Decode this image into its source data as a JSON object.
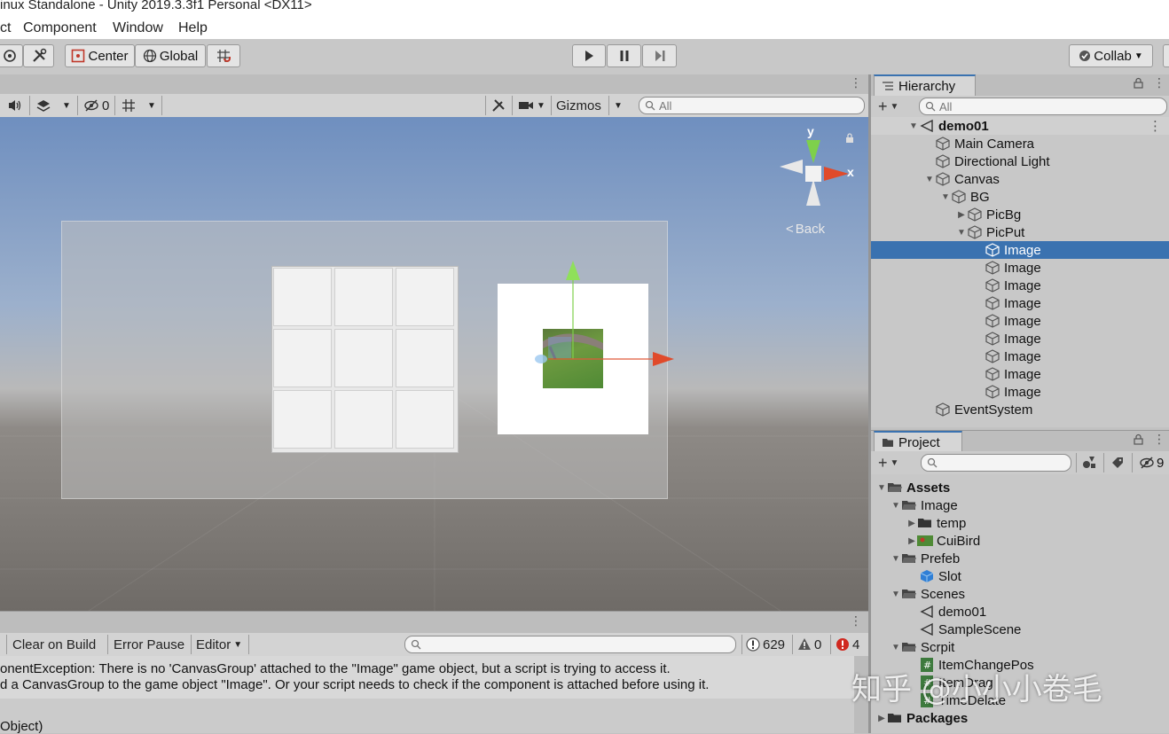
{
  "window": {
    "title": "inux Standalone - Unity 2019.3.3f1 Personal <DX11>"
  },
  "menu": [
    "ct",
    "Component",
    "Window",
    "Help"
  ],
  "toolbar": {
    "center_label": "Center",
    "global_label": "Global",
    "collab_label": "Collab"
  },
  "scene": {
    "hidden_count": "0",
    "gizmos_label": "Gizmos",
    "search_placeholder": "All",
    "back_label": "Back",
    "axis_y": "y",
    "axis_x": "x"
  },
  "console": {
    "clear_on_build": "Clear on Build",
    "error_pause": "Error Pause",
    "editor_label": "Editor",
    "info_count": "629",
    "warn_count": "0",
    "error_count": "4",
    "lines": [
      "onentException: There is no 'CanvasGroup' attached to the \"Image\" game object, but a script is trying to access it.",
      "d a CanvasGroup to the game object \"Image\". Or your script needs to check if the component is attached before using it.",
      "Object)"
    ]
  },
  "hierarchy": {
    "tab_label": "Hierarchy",
    "search_placeholder": "All",
    "items": [
      {
        "label": "demo01"
      },
      {
        "label": "Main Camera"
      },
      {
        "label": "Directional Light"
      },
      {
        "label": "Canvas"
      },
      {
        "label": "BG"
      },
      {
        "label": "PicBg"
      },
      {
        "label": "PicPut"
      },
      {
        "label": "Image"
      },
      {
        "label": "Image"
      },
      {
        "label": "Image"
      },
      {
        "label": "Image"
      },
      {
        "label": "Image"
      },
      {
        "label": "Image"
      },
      {
        "label": "Image"
      },
      {
        "label": "Image"
      },
      {
        "label": "Image"
      },
      {
        "label": "EventSystem"
      }
    ]
  },
  "project": {
    "tab_label": "Project",
    "hidden_count": "9",
    "items": [
      {
        "label": "Assets"
      },
      {
        "label": "Image"
      },
      {
        "label": "temp"
      },
      {
        "label": "CuiBird"
      },
      {
        "label": "Prefeb"
      },
      {
        "label": "Slot"
      },
      {
        "label": "Scenes"
      },
      {
        "label": "demo01"
      },
      {
        "label": "SampleScene"
      },
      {
        "label": "Scrpit"
      },
      {
        "label": "ItemChangePos"
      },
      {
        "label": "ItemDrag"
      },
      {
        "label": "TimeDelate"
      },
      {
        "label": "Packages"
      }
    ]
  },
  "watermark": "知乎 @小小小卷毛",
  "colors": {
    "selection": "#3a72b0",
    "panel": "#c8c8c8",
    "toolbar": "#c8c8c8"
  }
}
